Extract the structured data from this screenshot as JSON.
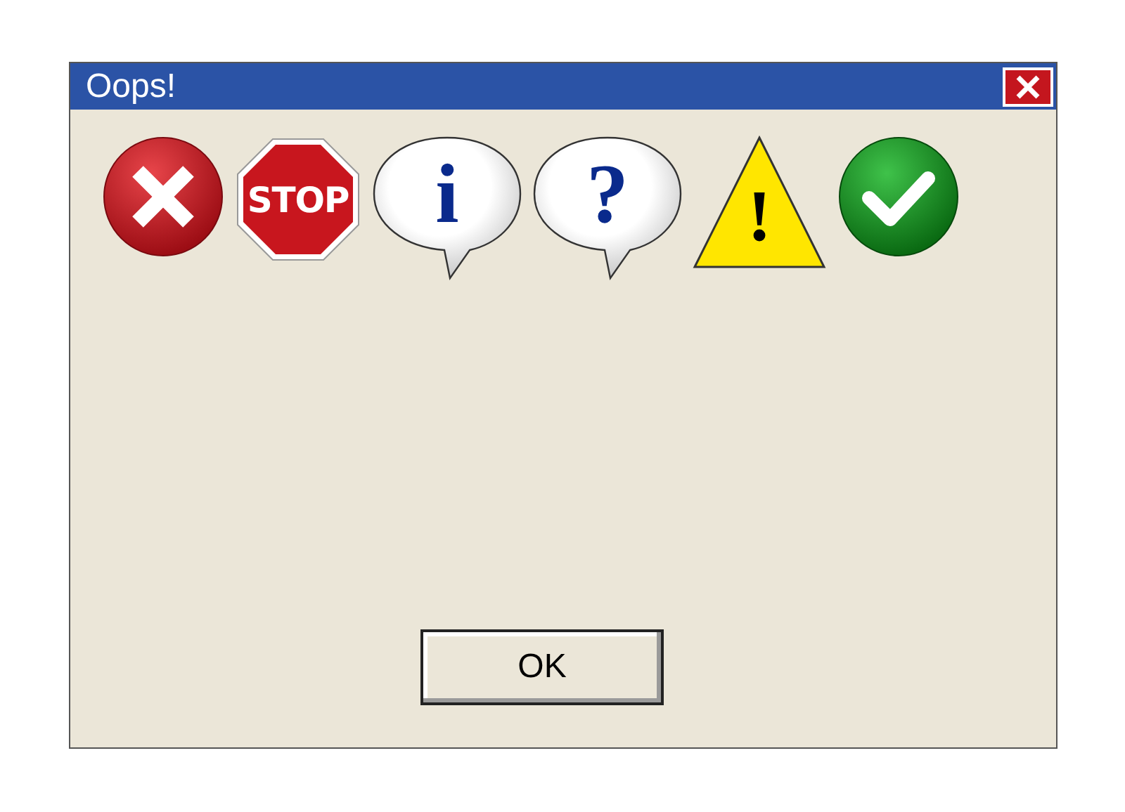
{
  "window": {
    "title": "Oops!"
  },
  "icons": [
    {
      "kind": "error"
    },
    {
      "kind": "stop",
      "label": "STOP"
    },
    {
      "kind": "info",
      "glyph": "i"
    },
    {
      "kind": "question",
      "glyph": "?"
    },
    {
      "kind": "warning",
      "glyph": "!"
    },
    {
      "kind": "success"
    }
  ],
  "buttons": [
    "OK"
  ]
}
